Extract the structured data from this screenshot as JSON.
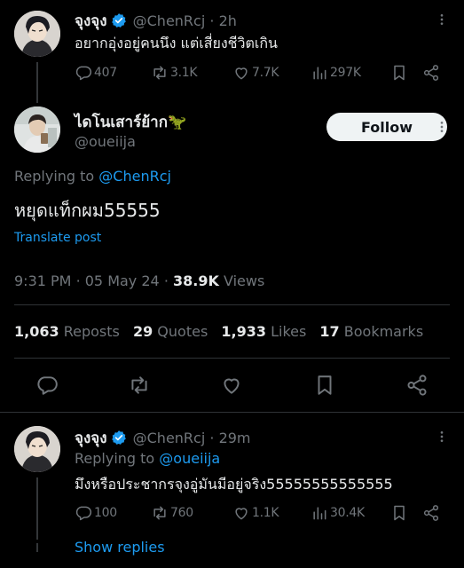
{
  "reply_parent": {
    "name": "จุงจุง",
    "handle": "@ChenRcj",
    "time": "2h",
    "text": "อยากอุ่งอยู่คนนึง แต่เสี่ยงชีวิตเกิน",
    "stats": {
      "replies": "407",
      "reposts": "3.1K",
      "likes": "7.7K",
      "views": "297K"
    }
  },
  "main_tweet": {
    "name": "ไดโนเสาร์ย้าก🦖",
    "handle": "@oueiija",
    "follow_label": "Follow",
    "replying_prefix": "Replying to",
    "replying_to": "@ChenRcj",
    "text": "หยุดแท็กผม55555",
    "translate_label": "Translate post",
    "time": "9:31 PM",
    "date": "05 May 24",
    "views_count": "38.9K",
    "views_label": "Views",
    "engagement": {
      "reposts_count": "1,063",
      "reposts_label": "Reposts",
      "quotes_count": "29",
      "quotes_label": "Quotes",
      "likes_count": "1,933",
      "likes_label": "Likes",
      "bookmarks_count": "17",
      "bookmarks_label": "Bookmarks"
    }
  },
  "reply_child": {
    "name": "จุงจุง",
    "handle": "@ChenRcj",
    "time": "29m",
    "replying_prefix": "Replying to",
    "replying_to": "@oueiija",
    "text": "มึงหรือประชากรจุงอู่มันมีอยู่จริง55555555555555",
    "stats": {
      "replies": "100",
      "reposts": "760",
      "likes": "1.1K",
      "views": "30.4K"
    },
    "show_replies_label": "Show replies"
  },
  "colors": {
    "accent": "#1d9bf0",
    "muted": "#71767b",
    "text": "#e7e9ea",
    "background": "#000000"
  },
  "icons": [
    "reply-icon",
    "repost-icon",
    "like-icon",
    "views-icon",
    "bookmark-icon",
    "share-icon",
    "verified-icon",
    "more-icon",
    "dinosaur-emoji"
  ]
}
